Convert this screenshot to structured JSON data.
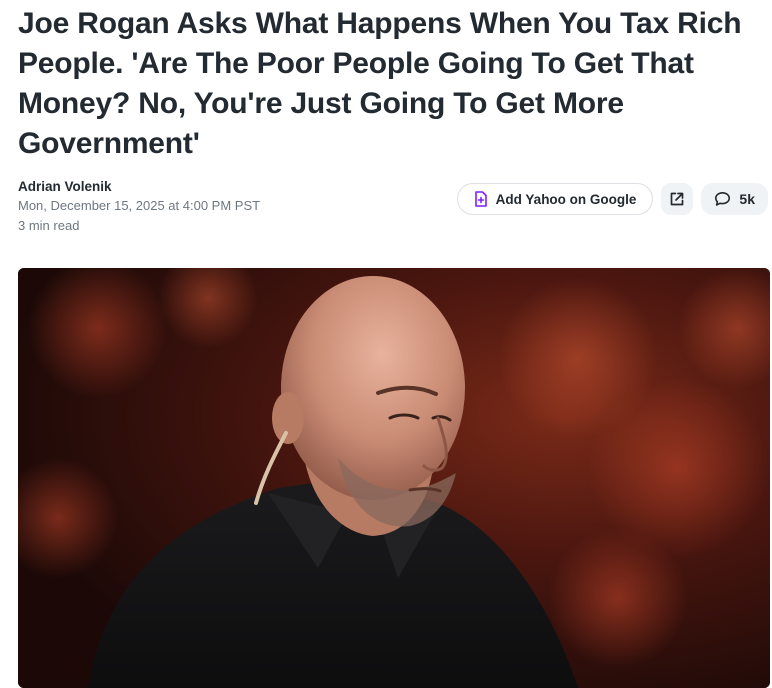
{
  "article": {
    "headline": "Joe Rogan Asks What Happens When You Tax Rich People. 'Are The Poor People Going To Get That Money? No, You're Just Going To Get More Government'",
    "author": "Adrian Volenik",
    "date": "Mon, December 15, 2025 at 4:00 PM PST",
    "read_time": "3 min read"
  },
  "actions": {
    "add_google_label": "Add Yahoo on Google",
    "add_google_icon": "document-plus-icon",
    "share_icon": "share-external-icon",
    "comments_icon": "comment-bubble-icon",
    "comments_count": "5k"
  },
  "colors": {
    "accent_purple": "#7e1fff",
    "headline": "#232a31",
    "meta_gray": "#6e7780"
  }
}
